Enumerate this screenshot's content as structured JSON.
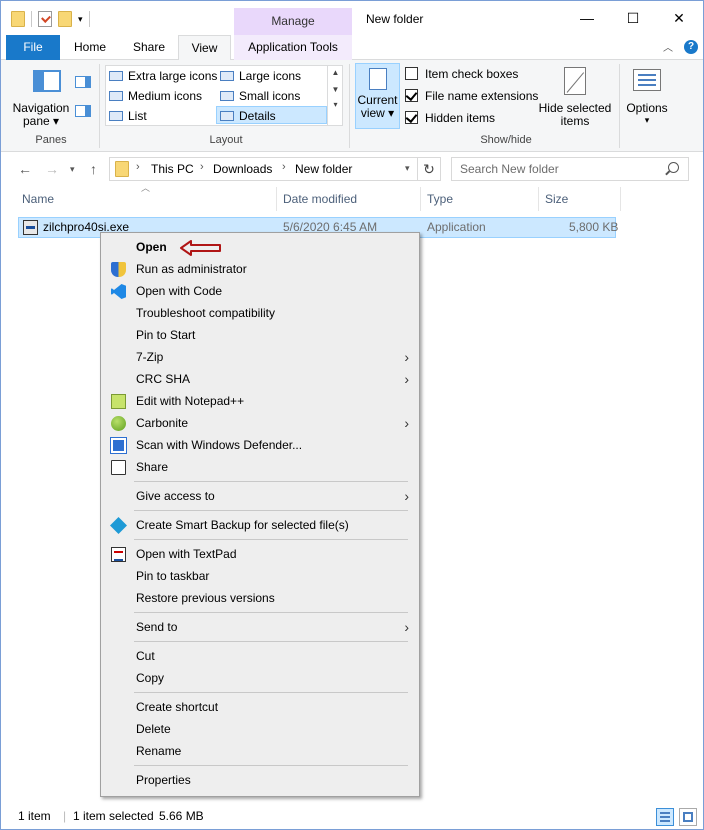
{
  "window": {
    "title": "New folder",
    "manage_label": "Manage",
    "minimize_glyph": "—",
    "maximize_glyph": "☐",
    "close_glyph": "✕"
  },
  "tabs": [
    {
      "label": "File"
    },
    {
      "label": "Home"
    },
    {
      "label": "Share"
    },
    {
      "label": "View"
    },
    {
      "label": "Application Tools"
    }
  ],
  "ribbon": {
    "panes": {
      "navigation_pane": "Navigation",
      "navigation_pane_2": "pane ▾",
      "group_label": "Panes"
    },
    "layout": {
      "items": [
        "Extra large icons",
        "Large icons",
        "Medium icons",
        "Small icons",
        "List",
        "Details"
      ],
      "selected": "Details",
      "group_label": "Layout"
    },
    "current_view": {
      "line1": "Current",
      "line2": "view ▾"
    },
    "show_hide": {
      "checkboxes": [
        {
          "label": "Item check boxes",
          "checked": false
        },
        {
          "label": "File name extensions",
          "checked": true
        },
        {
          "label": "Hidden items",
          "checked": true
        }
      ],
      "hide_selected_line1": "Hide selected",
      "hide_selected_line2": "items",
      "group_label": "Show/hide"
    },
    "options": {
      "label": "Options",
      "caret": "▾"
    }
  },
  "address": {
    "segments": [
      "This PC",
      "Downloads",
      "New folder"
    ],
    "search_placeholder": "Search New folder"
  },
  "columns": [
    "Name",
    "Date modified",
    "Type",
    "Size"
  ],
  "file": {
    "name": "zilchpro40si.exe",
    "date_modified": "5/6/2020 6:45 AM",
    "type": "Application",
    "size": "5,800 KB"
  },
  "context_menu": {
    "items": [
      {
        "label": "Open",
        "bold": true
      },
      {
        "label": "Run as administrator",
        "icon": "shield-icon"
      },
      {
        "label": "Open with Code",
        "icon": "vscode-icon"
      },
      {
        "label": "Troubleshoot compatibility"
      },
      {
        "label": "Pin to Start"
      },
      {
        "label": "7-Zip",
        "submenu": true
      },
      {
        "label": "CRC SHA",
        "submenu": true
      },
      {
        "label": "Edit with Notepad++",
        "icon": "notepad-plus-plus-icon"
      },
      {
        "label": "Carbonite",
        "icon": "carbonite-icon",
        "submenu": true
      },
      {
        "label": "Scan with Windows Defender...",
        "icon": "windows-defender-icon"
      },
      {
        "label": "Share",
        "icon": "share-icon"
      },
      {
        "label": "Give access to",
        "submenu": true
      },
      {
        "label": "Create Smart Backup for selected file(s)",
        "icon": "smart-backup-icon"
      },
      {
        "label": "Open with TextPad",
        "icon": "textpad-icon"
      },
      {
        "label": "Pin to taskbar"
      },
      {
        "label": "Restore previous versions"
      },
      {
        "label": "Send to",
        "submenu": true
      },
      {
        "label": "Cut"
      },
      {
        "label": "Copy"
      },
      {
        "label": "Create shortcut"
      },
      {
        "label": "Delete"
      },
      {
        "label": "Rename"
      },
      {
        "label": "Properties"
      }
    ],
    "submenu_glyph": "›"
  },
  "status": {
    "item_count": "1 item",
    "selection": "1 item selected",
    "selection_size": "5.66 MB"
  },
  "colors": {
    "accent": "#1979ca",
    "selection": "#cce8ff",
    "manage_tab": "#e9d8fb",
    "annotation_arrow": "#b01515"
  }
}
